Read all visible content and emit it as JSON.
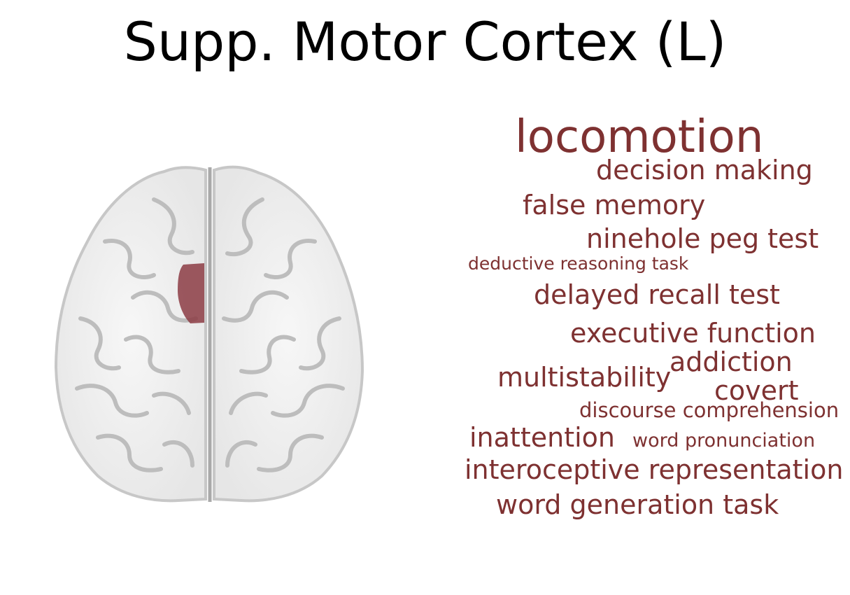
{
  "title": "Supp. Motor Cortex (L)",
  "colors": {
    "term_color": "#7e3131",
    "region_highlight": "#8c3c44",
    "brain_fill": "#f1f1f1",
    "brain_outline": "#c7c7c7",
    "sulci": "#bdbdbd"
  },
  "brain": {
    "view": "axial",
    "highlighted_region": "Supp. Motor Cortex (L)"
  },
  "word_cloud": {
    "terms": [
      {
        "text": "locomotion"
      },
      {
        "text": "decision making"
      },
      {
        "text": "false memory"
      },
      {
        "text": "ninehole peg test"
      },
      {
        "text": "deductive reasoning task"
      },
      {
        "text": "delayed recall test"
      },
      {
        "text": "executive function"
      },
      {
        "text": "addiction"
      },
      {
        "text": "multistability"
      },
      {
        "text": "covert"
      },
      {
        "text": "discourse comprehension"
      },
      {
        "text": "inattention"
      },
      {
        "text": "word pronunciation"
      },
      {
        "text": "interoceptive representation"
      },
      {
        "text": "word generation task"
      }
    ]
  }
}
